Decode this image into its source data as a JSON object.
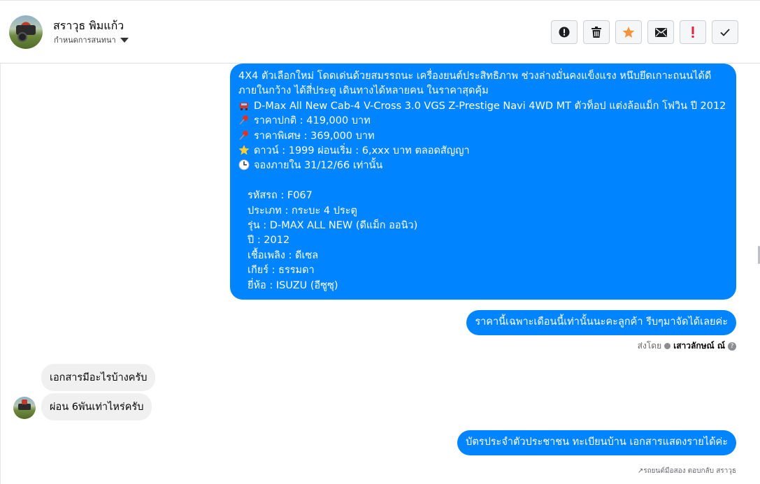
{
  "header": {
    "contact_name": "สราวุธ พิมแก้ว",
    "conversation_settings": "กำหนดการสนทนา"
  },
  "toolbar": {
    "icons": [
      "alert-circle-icon",
      "trash-icon",
      "star-icon",
      "envelope-icon",
      "exclamation-icon",
      "check-icon"
    ],
    "star_color": "#f7923b",
    "exclamation_color": "#e41e3f"
  },
  "messages": {
    "car_listing": {
      "line1": "4X4 ตัวเลือกใหม่ โดดเด่นด้วยสมรรถนะ เครื่องยนต์ประสิทธิภาพ ช่วงล่างมั่นคงแข็งแรง หนึบยึดเกาะถนนได้ดี",
      "line2": "ภายในกว้าง ได้สี่ประตู เดินทางได้หลายคน ในราคาสุดคุ้ม",
      "model": "D-Max All New Cab-4 V-Cross 3.0 VGS Z-Prestige Navi 4WD MT ตัวท็อป แต่งล้อแม็ก โฟวิน ปี 2012",
      "normal_price": "ราคาปกติ : 419,000 บาท",
      "special_price": "ราคาพิเศษ : 369,000 บาท",
      "down_payment": "ดาวน์ : 1999 ผ่อนเริ่ม : 6,xxx บาท ตลอดสัญญา",
      "deadline": "จองภายใน 31/12/66 เท่านั้น",
      "car_code": "รหัสรถ : F067",
      "type": "ประเภท : กระบะ 4 ประตู",
      "model_name": "รุ่น : D-MAX ALL NEW (ดีแม็ก ออนิว)",
      "year": "ปี : 2012",
      "fuel": "เชื้อเพลิง : ดีเซล",
      "gear": "เกียร์ : ธรรมดา",
      "brand": "ยี่ห้อ : ISUZU (อีซูซุ)"
    },
    "promo_reply": "ราคานี้เฉพาะเดือนนี้เท่านั้นนะคะลูกค้า รีบๆมาจัดได้เลยค่ะ",
    "sent_by_prefix": "ส่งโดย",
    "sent_by_name": "เสาวลักษณ์ ณ์",
    "customer_question": "เอกสารมีอะไรบ้างครับ",
    "customer_installment": "ผ่อน 6พันเท่าไหร่ครับ",
    "documents_reply": "บัตรประจำตัวประชาชน ทะเบียนบ้าน เอกสารแสดงรายได้ค่ะ",
    "footer_note": "รถยนต์มือสอง ตอบกลับ สราวุธ"
  },
  "colors": {
    "bubble_blue": "#0084ff",
    "bubble_gray": "#f0f0f0"
  }
}
